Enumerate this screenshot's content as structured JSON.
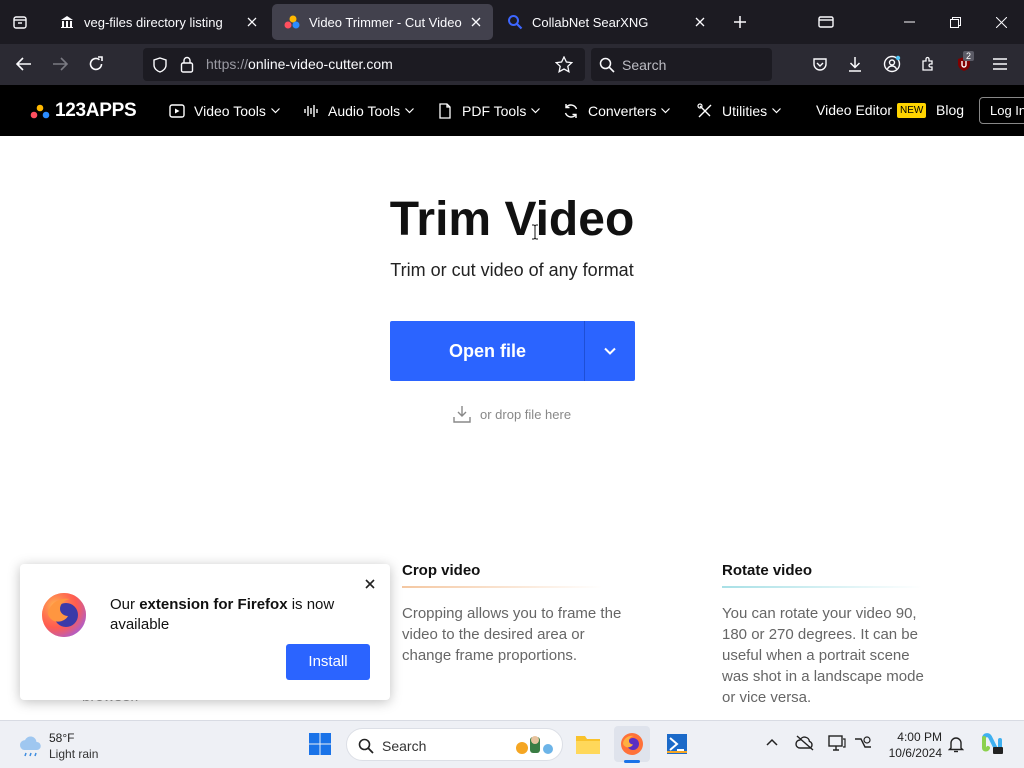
{
  "browser": {
    "tabs": [
      {
        "title": "veg-files directory listing",
        "active": false
      },
      {
        "title": "Video Trimmer - Cut Video Onli",
        "active": true
      },
      {
        "title": "CollabNet SearXNG",
        "active": false
      }
    ],
    "url_scheme": "https://",
    "url_host": "online-video-cutter.com",
    "search_placeholder": "Search",
    "extension_badge": "2"
  },
  "site": {
    "logo": "123APPS",
    "menu": [
      {
        "label": "Video Tools"
      },
      {
        "label": "Audio Tools"
      },
      {
        "label": "PDF Tools"
      },
      {
        "label": "Converters"
      },
      {
        "label": "Utilities"
      }
    ],
    "video_editor": "Video Editor",
    "new_badge": "NEW",
    "blog": "Blog",
    "login": "Log In"
  },
  "main": {
    "title": "Trim Video",
    "subtitle": "Trim or cut video of any format",
    "open_button": "Open file",
    "drop_text": "or drop file here"
  },
  "features": [
    {
      "title": "Crop video",
      "text": "Cropping allows you to frame the video to the desired area or change frame proportions.",
      "accent": "#f4c7a1"
    },
    {
      "title": "Rotate video",
      "text": "You can rotate your video 90, 180 or 270 degrees. It can be useful when a portrait scene was shot in a landscape mode or vice versa.",
      "accent": "#a8e0e6"
    }
  ],
  "popup": {
    "msg_pre": "Our ",
    "msg_bold": "extension for Firefox",
    "msg_post": " is now available",
    "install": "Install",
    "behind_text": "browser."
  },
  "taskbar": {
    "temp": "58°F",
    "condition": "Light rain",
    "search": "Search",
    "time": "4:00 PM",
    "date": "10/6/2024"
  },
  "colors": {
    "accent": "#2b64ff",
    "header_bg": "#000000",
    "tab_bg": "#1c1b22"
  }
}
